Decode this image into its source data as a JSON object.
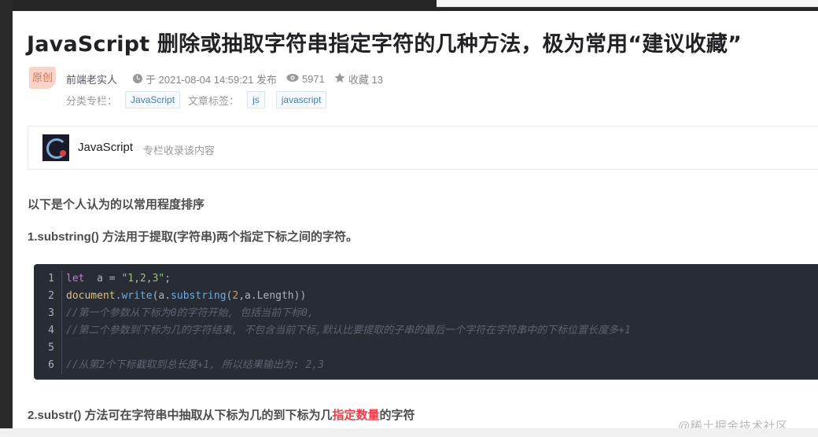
{
  "article": {
    "title": "JavaScript 删除或抽取字符串指定字符的几种方法，极为常用“建议收藏”",
    "badge": "原创",
    "author": "前端老实人",
    "published": "于 2021-08-04 14:59:21 发布",
    "views": "5971",
    "favorites": "收藏 13",
    "category_label": "分类专栏：",
    "category_tag": "JavaScript",
    "tags_label": "文章标签：",
    "tags": [
      "js",
      "javascript"
    ]
  },
  "column": {
    "name": "JavaScript",
    "subtitle": "专栏收录该内容"
  },
  "content": {
    "intro": "以下是个人认为的以常用程度排序",
    "section1": "1.substring() 方法用于提取(字符串)两个指定下标之间的字符。",
    "section2_before": "2.substr() 方法可在字符串中抽取从下标为几的到下标为几",
    "section2_highlight": "指定数量",
    "section2_after": "的字符"
  },
  "code": {
    "line_numbers": [
      "1",
      "2",
      "3",
      "4",
      "5",
      "6"
    ],
    "l1_kw": "let",
    "l1_mid": "  a = ",
    "l1_str": "\"1,2,3\"",
    "l1_end": ";",
    "l2_obj": "document",
    "l2_dot": ".",
    "l2_fn": "write",
    "l2_a": "(a.",
    "l2_fn2": "substring",
    "l2_b": "(",
    "l2_num": "2",
    "l2_c": ",a.Length))",
    "l3": "//第一个参数从下标为0的字符开始, 包括当前下标0,",
    "l4": "//第二个参数到下标为几的字符结束, 不包含当前下标,默认比要提取的子串的最后一个字符在字符串中的下标位置长度多+1",
    "l6": "//从第2个下标截取到总长度+1, 所以结果输出为: 2,3"
  },
  "watermark": "@稀土掘金技术社区",
  "colors": {
    "accent_red": "#f33b45",
    "tag_blue": "#3f7cc0",
    "badge_bg": "#f9d3c8",
    "code_bg": "#282c34"
  }
}
